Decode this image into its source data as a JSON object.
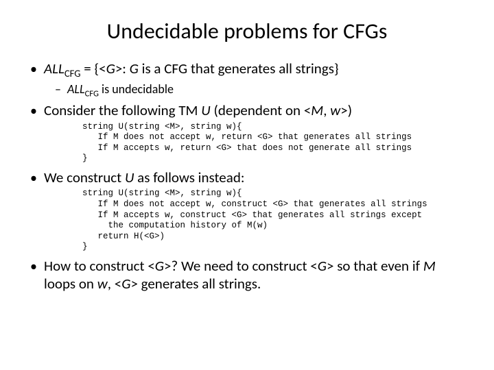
{
  "title": "Undecidable problems for CFGs",
  "bullets": {
    "b1_pre": "ALL",
    "b1_sub": "CFG",
    "b1_mid": " = {<",
    "b1_g": "G",
    "b1_post": ">: ",
    "b1_g2": "G",
    "b1_rest": " is a CFG that generates all strings}",
    "s1_pre": "ALL",
    "s1_sub": "CFG",
    "s1_post": " is undecidable",
    "b2_pre": "Consider the following TM ",
    "b2_u": "U",
    "b2_mid": " (dependent on <",
    "b2_m": "M",
    "b2_mid2": ", ",
    "b2_w": "w",
    "b2_post": ">)",
    "b3_pre": "We construct ",
    "b3_u": "U",
    "b3_post": " as follows instead:",
    "b4_pre": "How to construct <",
    "b4_g": "G",
    "b4_mid": ">? We need to construct <",
    "b4_g2": "G",
    "b4_mid2": "> so that even if ",
    "b4_m": "M",
    "b4_mid3": " loops on ",
    "b4_w": "w",
    "b4_mid4": ", <",
    "b4_g3": "G",
    "b4_post": "> generates all strings."
  },
  "code1": "string U(string <M>, string w){\n   If M does not accept w, return <G> that generates all strings\n   If M accepts w, return <G> that does not generate all strings\n}",
  "code2": "string U(string <M>, string w){\n   If M does not accept w, construct <G> that generates all strings\n   If M accepts w, construct <G> that generates all strings except\n     the computation history of M(w)\n   return H(<G>)\n}"
}
